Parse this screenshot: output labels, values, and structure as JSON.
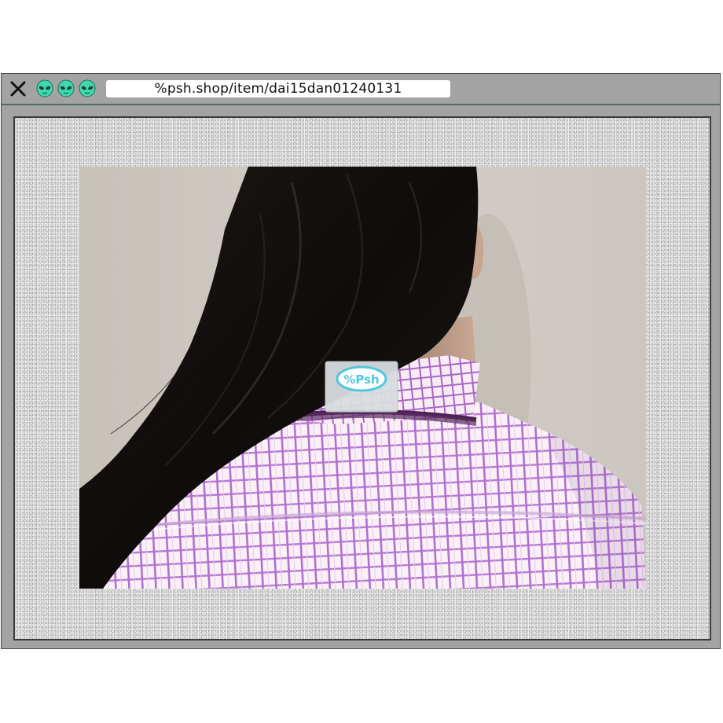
{
  "browser": {
    "url": "%psh.shop/item/dai15dan01240131",
    "close_icon": "close-x-icon",
    "window_icons": [
      "alien-head-icon",
      "alien-head-icon",
      "alien-head-icon"
    ],
    "icon_color": "#3fd9b0"
  },
  "photo": {
    "subject": "product-photo",
    "tag_text": "%Psh",
    "shirt_color": "#fbf0f6",
    "check_color": "#a865c8",
    "tag_color": "#4fc7dd"
  }
}
